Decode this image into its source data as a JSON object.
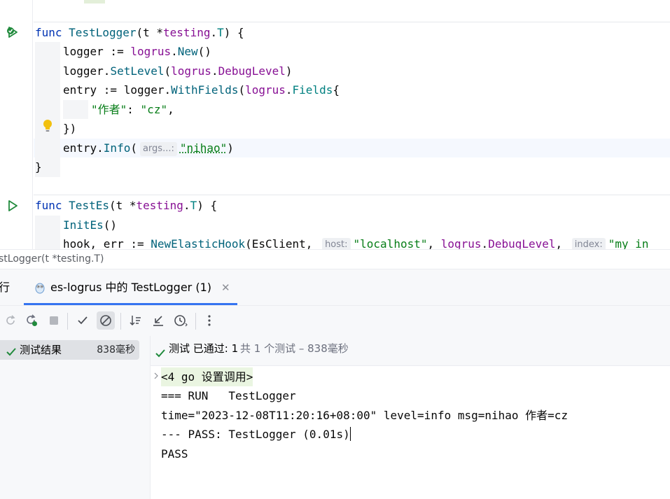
{
  "editor": {
    "lines": {
      "l1_kw": "func",
      "l1_name": "TestLogger",
      "l1_params_a": "(t *",
      "l1_params_pkg": "testing",
      "l1_params_dot": ".",
      "l1_params_type": "T",
      "l1_params_b": ") {",
      "l2_a": "logger := ",
      "l2_pkg": "logrus",
      "l2_dot": ".",
      "l2_fn": "New",
      "l2_b": "()",
      "l3_a": "logger.",
      "l3_fn": "SetLevel",
      "l3_b": "(",
      "l3_pkg": "logrus",
      "l3_dot": ".",
      "l3_const": "DebugLevel",
      "l3_c": ")",
      "l4_a": "entry := logger.",
      "l4_fn": "WithFields",
      "l4_b": "(",
      "l4_pkg": "logrus",
      "l4_dot": ".",
      "l4_type": "Fields",
      "l4_c": "{",
      "l5_key": "\"作者\"",
      "l5_colon": ": ",
      "l5_val": "\"cz\"",
      "l5_comma": ",",
      "l6": "})",
      "l7_a": "entry.",
      "l7_fn": "Info",
      "l7_b": "(",
      "l7_hint": "args...:",
      "l7_str": "\"nihao\"",
      "l7_c": ")",
      "l8": "}",
      "l9_kw": "func",
      "l9_name": "TestEs",
      "l9_params_a": "(t *",
      "l9_params_pkg": "testing",
      "l9_params_dot": ".",
      "l9_params_type": "T",
      "l9_params_b": ") {",
      "l10_fn": "InitEs",
      "l10_b": "()",
      "l11_a": "hook, err := ",
      "l11_fn": "NewElasticHook",
      "l11_b": "(EsClient, ",
      "l11_hint1": "host:",
      "l11_str1": "\"localhost\"",
      "l11_c": ", ",
      "l11_pkg": "logrus",
      "l11_dot": ".",
      "l11_const": "DebugLevel",
      "l11_d": ", ",
      "l11_hint2": "index:",
      "l11_str2": "\"my_in"
    }
  },
  "breadcrumb": "stLogger(t *testing.T)",
  "tabs": {
    "run_label": "行",
    "active_label": "es-logrus 中的 TestLogger (1)"
  },
  "tree": {
    "item_label": "测试结果",
    "item_time": "838毫秒"
  },
  "status": {
    "passed": "测试 已通过: 1",
    "total": "共 1 个测试 – 838毫秒"
  },
  "console": {
    "line1": "<4 go 设置调用>",
    "line2": "=== RUN   TestLogger",
    "line3": "time=\"2023-12-08T11:20:16+08:00\" level=info msg=nihao 作者=cz",
    "line4": "--- PASS: TestLogger (0.01s)",
    "line5": "PASS"
  },
  "colors": {
    "accent": "#3574f0",
    "pass_green": "#208a3c"
  }
}
